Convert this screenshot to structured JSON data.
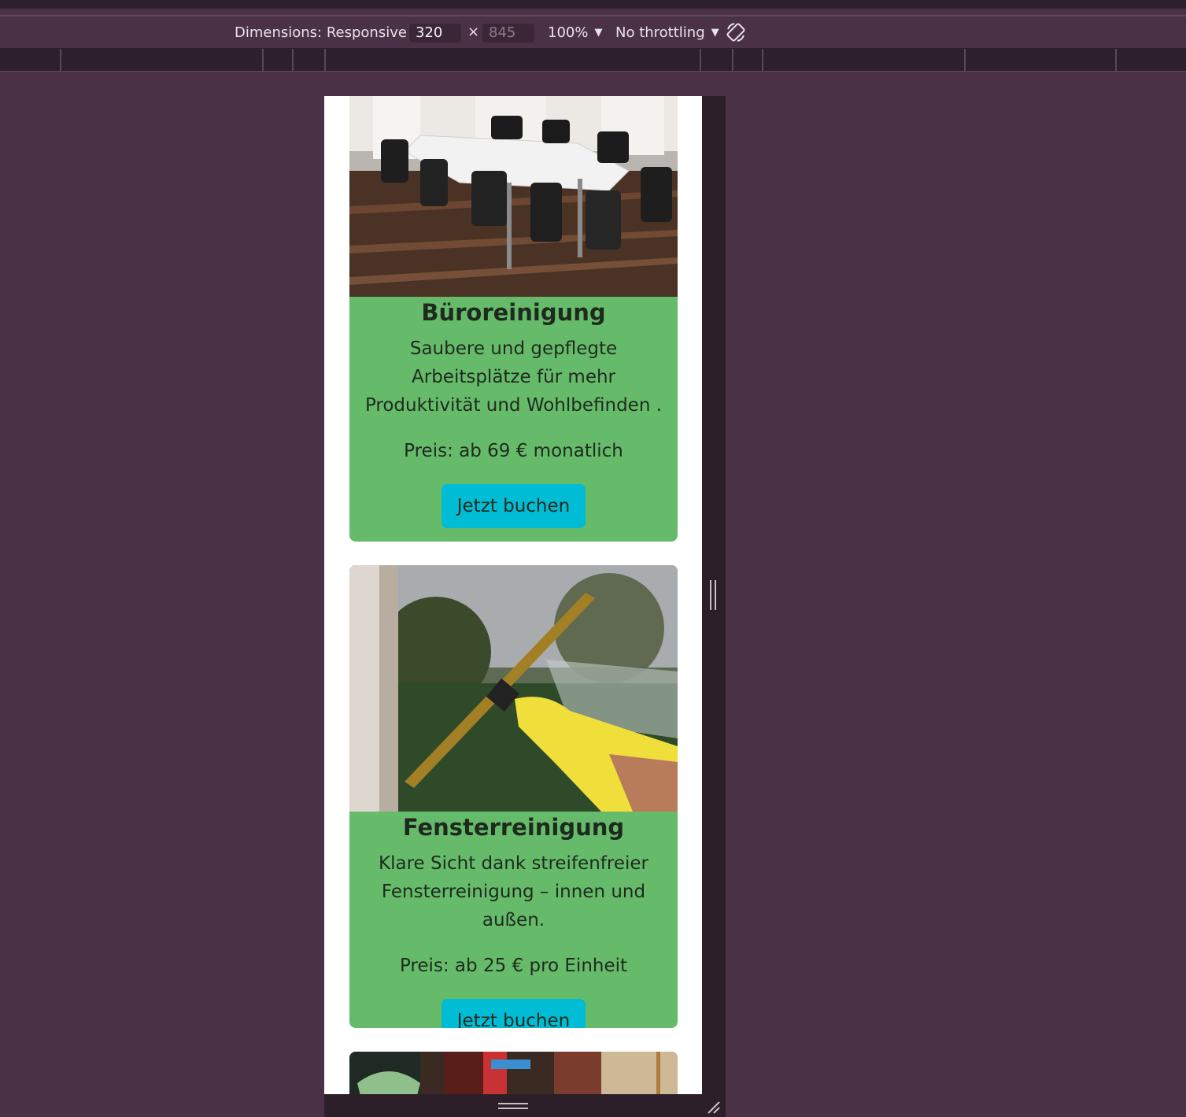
{
  "devtools": {
    "dimensions_label": "Dimensions: Responsive",
    "width_value": "320",
    "height_placeholder": "845",
    "times": "×",
    "zoom": "100%",
    "throttling": "No throttling",
    "caret": "▼"
  },
  "cards": [
    {
      "title": "Büroreinigung",
      "description": "Saubere und gepflegte Arbeitsplätze für mehr Produktivität und Wohlbefinden .",
      "price": "Preis: ab 69 € monatlich",
      "button": "Jetzt buchen"
    },
    {
      "title": "Fensterreinigung",
      "description": "Klare Sicht dank streifenfreier Fensterreinigung – innen und außen.",
      "price": "Preis: ab 25 € pro Einheit",
      "button": "Jetzt buchen"
    }
  ],
  "colors": {
    "card_bg": "#66bb6a",
    "button_bg": "#00bcd4",
    "devtools_bg": "#4b3146"
  }
}
